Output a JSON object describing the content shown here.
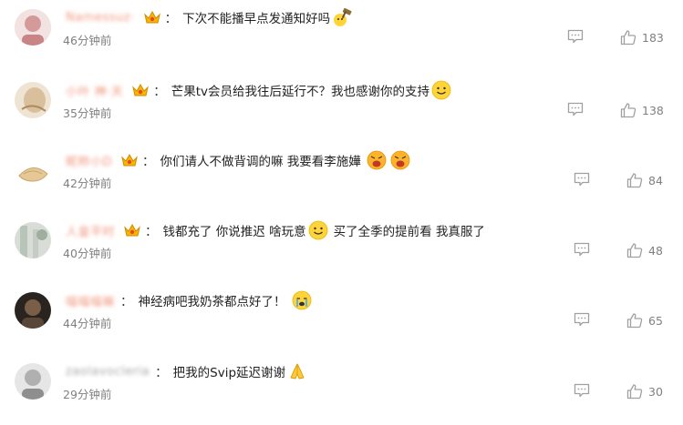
{
  "comments": [
    {
      "username": "Namessuz·",
      "text_parts": [
        "下次不能播早点发通知好吗"
      ],
      "emoji_after": [
        "hammer-emoji"
      ],
      "time": "46分钟前",
      "likes": "183",
      "avatar_color": "#d9a0a0"
    },
    {
      "username": "小叶 神·天",
      "text_parts": [
        "芒果tv会员给我往后延行不？我也感谢你的支持"
      ],
      "emoji_after": [
        "smile-emoji"
      ],
      "time": "35分钟前",
      "likes": "138",
      "avatar_color": "#c9a98a"
    },
    {
      "username": "昵称小D",
      "text_parts": [
        "你们请人不做背调的嘛 我要看李施嬅"
      ],
      "emoji_after": [
        "angry-emoji",
        "angry-emoji"
      ],
      "time": "42分钟前",
      "likes": "84",
      "avatar_color": "#e8d5b0"
    },
    {
      "username": "人皇平时",
      "text_parts": [
        "钱都充了 你说推迟 啥玩意",
        "买了全季的提前看 我真服了"
      ],
      "emoji_after": [
        "smile-emoji"
      ],
      "time": "40分钟前",
      "likes": "48",
      "avatar_color": "#a8b8a8"
    },
    {
      "username": "喵喵喵嘛",
      "text_parts": [
        "神经病吧我奶茶都点好了！"
      ],
      "emoji_after": [
        "crying-emoji"
      ],
      "time": "44分钟前",
      "likes": "65",
      "avatar_color": "#5a4a3a"
    },
    {
      "username": "zaolavocleria",
      "text_parts": [
        "把我的Svip延迟谢谢"
      ],
      "emoji_after": [
        "pray-emoji"
      ],
      "time": "29分钟前",
      "likes": "30",
      "avatar_color": "#9a9a9a"
    }
  ],
  "colors": {
    "username": "#eb7350",
    "time": "#808080",
    "text": "#222222",
    "icon": "#b0b0b0"
  }
}
